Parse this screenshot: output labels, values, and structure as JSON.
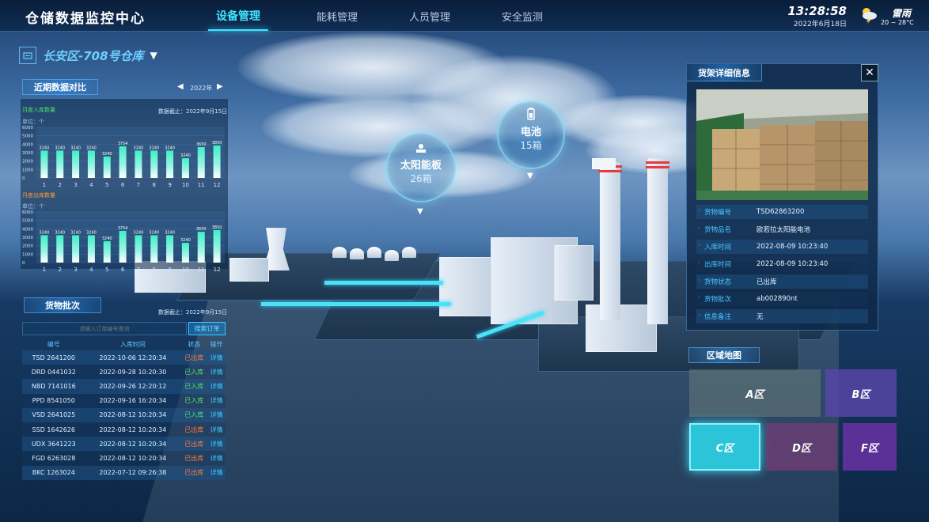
{
  "header": {
    "title": "仓储数据监控中心",
    "nav": [
      "设备管理",
      "能耗管理",
      "人员管理",
      "安全监测"
    ],
    "time": "13:28:58",
    "date": "2022年6月18日",
    "weather": {
      "icon": "thunder-cloud-icon",
      "label": "雷雨",
      "temp": "20 ~ 28°C"
    }
  },
  "warehouse": {
    "name": "长安区-708号仓库"
  },
  "recent": {
    "title": "近期数据对比",
    "year": "2022年",
    "deadline": "数据截止：2022年9月15日",
    "chart_in": {
      "label": "月度入库数量",
      "unit": "单位：个"
    },
    "chart_out": {
      "label": "月度出库数量",
      "unit": "单位：个"
    }
  },
  "chart_data": [
    {
      "type": "bar",
      "title": "月度入库数量",
      "ylabel": "单位：个",
      "categories": [
        "1",
        "2",
        "3",
        "4",
        "5",
        "6",
        "7",
        "8",
        "9",
        "10",
        "11",
        "12"
      ],
      "values": [
        3240,
        3240,
        3240,
        3240,
        2540,
        3754,
        3240,
        3240,
        3240,
        2340,
        3650,
        3850
      ],
      "data_labels": [
        "3240",
        "3240",
        "3240",
        "3240",
        "3240",
        "3754",
        "3240",
        "3240",
        "3240",
        "3240",
        "3650",
        "3850"
      ],
      "y_ticks": [
        "0",
        "1000",
        "2000",
        "3000",
        "4000",
        "5000",
        "6000"
      ],
      "ylim": [
        0,
        6000
      ]
    },
    {
      "type": "bar",
      "title": "月度出库数量",
      "ylabel": "单位：个",
      "categories": [
        "1",
        "2",
        "3",
        "4",
        "5",
        "6",
        "7",
        "8",
        "9",
        "10",
        "11",
        "12"
      ],
      "values": [
        3240,
        3240,
        3240,
        3240,
        2540,
        3754,
        3240,
        3240,
        3240,
        2340,
        3650,
        3850
      ],
      "data_labels": [
        "3240",
        "3240",
        "3240",
        "3240",
        "3240",
        "3754",
        "3240",
        "3240",
        "3240",
        "3240",
        "3650",
        "3850"
      ],
      "y_ticks": [
        "0",
        "1000",
        "2000",
        "3000",
        "4000",
        "5000",
        "6000"
      ],
      "ylim": [
        0,
        6000
      ]
    }
  ],
  "batch": {
    "title": "货物批次",
    "deadline": "数据截止：2022年9月15日",
    "search_placeholder": "请输入订单编号查询",
    "search_button": "搜索订单",
    "columns": [
      "编号",
      "入库时间",
      "状态",
      "操作"
    ],
    "rows": [
      {
        "id": "TSD 2641200",
        "time": "2022-10-06  12:20:34",
        "status": "已出库",
        "action": "详情"
      },
      {
        "id": "DRD 0441032",
        "time": "2022-09-28  10:20:30",
        "status": "已入库",
        "action": "详情"
      },
      {
        "id": "NBD 7141016",
        "time": "2022-09-26  12:20:12",
        "status": "已入库",
        "action": "详情"
      },
      {
        "id": "PPD 8541050",
        "time": "2022-09-16  16:20:34",
        "status": "已入库",
        "action": "详情"
      },
      {
        "id": "VSD 2641025",
        "time": "2022-08-12  10:20:34",
        "status": "已入库",
        "action": "详情"
      },
      {
        "id": "SSD 1642626",
        "time": "2022-08-12  10:20:34",
        "status": "已出库",
        "action": "详情"
      },
      {
        "id": "UDX 3641223",
        "time": "2022-08-12  10:20:34",
        "status": "已出库",
        "action": "详情"
      },
      {
        "id": "FGD 6263028",
        "time": "2022-08-12  10:20:34",
        "status": "已出库",
        "action": "详情"
      },
      {
        "id": "BKC 1263024",
        "time": "2022-07-12  09:26:38",
        "status": "已出库",
        "action": "详情"
      }
    ]
  },
  "bubbles": [
    {
      "name": "太阳能板",
      "count": "26箱",
      "icon": "solar-icon"
    },
    {
      "name": "电池",
      "count": "15箱",
      "icon": "battery-icon"
    }
  ],
  "detail": {
    "title": "货架详细信息",
    "rows": [
      {
        "k": "货物编号",
        "v": "TSD62863200"
      },
      {
        "k": "货物品名",
        "v": "欧若拉太阳能电池"
      },
      {
        "k": "入库时间",
        "v": "2022-08-09   10:23:40"
      },
      {
        "k": "出库时间",
        "v": "2022-08-09   10:23:40"
      },
      {
        "k": "货物状态",
        "v": "已出库"
      },
      {
        "k": "货物批次",
        "v": "ab002890nt"
      },
      {
        "k": "信息备注",
        "v": "无"
      }
    ]
  },
  "zones": {
    "title": "区域地图",
    "items": [
      "A区",
      "B区",
      "C区",
      "D区",
      "F区"
    ]
  },
  "colors": {
    "accent": "#3ee4ff",
    "in_status": "#4ee06a",
    "out_status": "#ff7a3a"
  }
}
